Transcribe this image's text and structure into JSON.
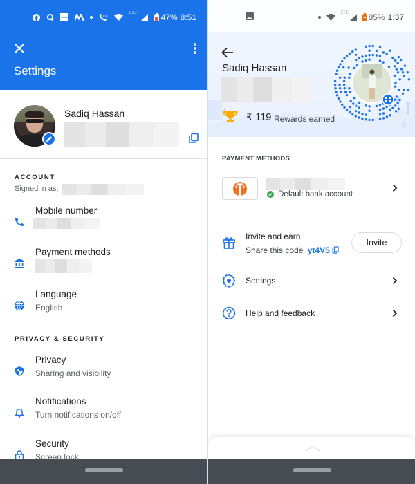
{
  "left": {
    "status_bar": {
      "icons": [
        "facebook-icon",
        "quora-icon",
        "news-icon",
        "myntra-icon",
        "dot-icon",
        "volte-call-icon",
        "wifi-icon",
        "lte-plus-icon",
        "signal-icon",
        "battery-icon"
      ],
      "lte_label": "LTE+",
      "battery": "47%",
      "time": "8:51"
    },
    "header": {
      "close_icon": "close-icon",
      "more_icon": "more-vert-icon",
      "title": "Settings"
    },
    "profile": {
      "name": "Sadiq Hassan",
      "email_redacted": true,
      "copy_icon": "copy-icon",
      "edit_icon": "edit-pencil-icon"
    },
    "account": {
      "heading": "ACCOUNT",
      "signed_in_label": "Signed in as:",
      "items": [
        {
          "label": "Mobile number",
          "icon": "phone-icon",
          "value_redacted": true
        },
        {
          "label": "Payment methods",
          "icon": "bank-icon",
          "value_redacted": true
        },
        {
          "label": "Language",
          "icon": "globe-icon",
          "value": "English"
        }
      ]
    },
    "privacy": {
      "heading": "PRIVACY & SECURITY",
      "items": [
        {
          "label": "Privacy",
          "icon": "shield-icon",
          "value": "Sharing and visibility"
        },
        {
          "label": "Notifications",
          "icon": "bell-icon",
          "value": "Turn notifications on/off"
        },
        {
          "label": "Security",
          "icon": "lock-icon",
          "value": "Screen lock"
        }
      ]
    }
  },
  "right": {
    "status_bar": {
      "icons": [
        "gallery-icon",
        "dot-icon",
        "wifi-icon",
        "lte-icon",
        "signal-icon",
        "battery-icon"
      ],
      "lte_label": "LTE",
      "battery": "85%",
      "time": "1:37"
    },
    "profile": {
      "back_icon": "back-arrow-icon",
      "name": "Sadiq Hassan",
      "upi_redacted": true,
      "rewards_amount": "₹ 119",
      "rewards_label": "Rewards earned",
      "qr_icon": "qr-code-icon"
    },
    "payment_methods": {
      "heading": "PAYMENT METHODS",
      "bank": {
        "name_redacted": true,
        "status": "Default bank account",
        "logo": "bank-logo-icon"
      }
    },
    "invite": {
      "title": "Invite and earn",
      "share_label": "Share this code",
      "code": "yt4V5",
      "button": "Invite"
    },
    "menu": [
      {
        "label": "Settings",
        "icon": "gear-icon"
      },
      {
        "label": "Help and feedback",
        "icon": "help-icon"
      }
    ],
    "colors": {
      "accent": "#1a73e8",
      "success": "#34a853",
      "bank_orange": "#f37021",
      "trophy": "#f9ab00"
    }
  }
}
